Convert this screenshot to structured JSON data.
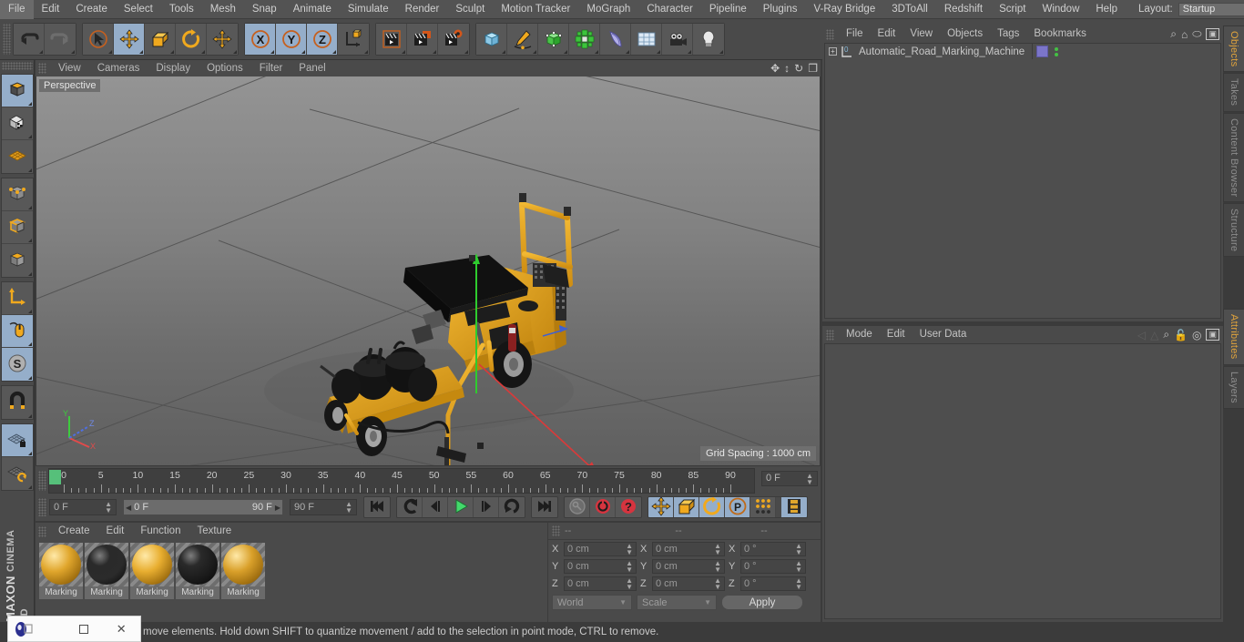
{
  "menubar": {
    "items": [
      "File",
      "Edit",
      "Create",
      "Select",
      "Tools",
      "Mesh",
      "Snap",
      "Animate",
      "Simulate",
      "Render",
      "Sculpt",
      "Motion Tracker",
      "MoGraph",
      "Character",
      "Pipeline",
      "Plugins",
      "V-Ray Bridge",
      "3DToAll",
      "Redshift",
      "Script",
      "Window",
      "Help"
    ],
    "layout_label": "Layout:",
    "layout_value": "Startup",
    "search_icon": "search-icon"
  },
  "toolbar": {
    "groups": [
      {
        "name": "history",
        "buttons": [
          {
            "name": "undo-button",
            "icon": "undo-icon",
            "active": false
          },
          {
            "name": "redo-button",
            "icon": "redo-icon",
            "active": false,
            "disabled": true
          }
        ]
      },
      {
        "name": "transform-tools",
        "buttons": [
          {
            "name": "live-selection-tool",
            "icon": "cursor-circle-icon",
            "active": false
          },
          {
            "name": "move-tool",
            "icon": "move-arrows-icon",
            "active": true
          },
          {
            "name": "scale-tool",
            "icon": "scale-box-icon",
            "active": false
          },
          {
            "name": "rotate-tool",
            "icon": "rotate-arc-icon",
            "active": false
          },
          {
            "name": "global-local-move-tool",
            "icon": "move-arrows-icon",
            "active": false
          }
        ]
      },
      {
        "name": "axis-locks",
        "buttons": [
          {
            "name": "lock-x-axis",
            "icon": "axis-x-icon",
            "active": true,
            "label": "X"
          },
          {
            "name": "lock-y-axis",
            "icon": "axis-y-icon",
            "active": true,
            "label": "Y"
          },
          {
            "name": "lock-z-axis",
            "icon": "axis-z-icon",
            "active": true,
            "label": "Z"
          },
          {
            "name": "world-object-coordinates",
            "icon": "world-axis-cube-icon",
            "active": false
          }
        ]
      },
      {
        "name": "render-tools",
        "buttons": [
          {
            "name": "render-view-button",
            "icon": "clapboard-view-icon",
            "active": false
          },
          {
            "name": "render-to-picture-viewer-button",
            "icon": "clapboard-picture-icon",
            "active": false
          },
          {
            "name": "render-settings-button",
            "icon": "clapboard-gear-icon",
            "active": false
          }
        ]
      },
      {
        "name": "create-objects",
        "buttons": [
          {
            "name": "add-primitive-cube-button",
            "icon": "blue-cube-icon",
            "active": false
          },
          {
            "name": "add-spline-button",
            "icon": "pen-spline-icon",
            "active": false
          },
          {
            "name": "add-generator-button",
            "icon": "green-cube-icon",
            "active": false
          },
          {
            "name": "add-mograph-button",
            "icon": "green-cluster-icon",
            "active": false
          },
          {
            "name": "add-deformer-button",
            "icon": "bend-deformer-icon",
            "active": false
          },
          {
            "name": "add-scene-object-button",
            "icon": "floor-grid-icon",
            "active": false
          },
          {
            "name": "add-camera-button",
            "icon": "camera-icon",
            "active": false
          },
          {
            "name": "add-light-button",
            "icon": "lightbulb-icon",
            "active": false
          }
        ]
      }
    ]
  },
  "lefttools": {
    "groups": [
      {
        "name": "mode-group-1",
        "buttons": [
          {
            "name": "make-editable-button",
            "icon": "editable-cube-icon",
            "active": true
          },
          {
            "name": "model-mode-button",
            "icon": "checker-cube-icon",
            "active": false
          },
          {
            "name": "texture-mode-button",
            "icon": "texture-grid-icon",
            "active": false
          }
        ]
      },
      {
        "name": "component-group",
        "buttons": [
          {
            "name": "points-mode-button",
            "icon": "points-cube-icon",
            "active": false
          },
          {
            "name": "edges-mode-button",
            "icon": "edges-cube-icon",
            "active": false
          },
          {
            "name": "polygons-mode-button",
            "icon": "polygons-cube-icon",
            "active": false
          }
        ]
      },
      {
        "name": "axis-group",
        "buttons": [
          {
            "name": "enable-axis-modification-button",
            "icon": "axis-L-icon",
            "active": false
          },
          {
            "name": "viewport-solo-button",
            "icon": "mouse-icon",
            "active": true
          },
          {
            "name": "enable-snapping-button",
            "icon": "snap-S-icon",
            "active": true
          }
        ]
      },
      {
        "name": "magnet-group",
        "buttons": [
          {
            "name": "magnet-tool-button",
            "icon": "magnet-icon",
            "active": false
          }
        ]
      },
      {
        "name": "workplane-group",
        "buttons": [
          {
            "name": "lock-workplane-button",
            "icon": "grid-lock-icon",
            "active": true
          },
          {
            "name": "planar-workplane-button",
            "icon": "grid-rotate-icon",
            "active": false
          }
        ]
      }
    ],
    "brand": "MAXON",
    "brand_sub": "CINEMA 4D"
  },
  "viewport": {
    "menu": [
      "View",
      "Cameras",
      "Display",
      "Options",
      "Filter",
      "Panel"
    ],
    "nav_icons": [
      "pan-icon",
      "dolly-icon",
      "rotate-icon",
      "maximize-icon"
    ],
    "label": "Perspective",
    "grid_spacing": "Grid Spacing : 1000 cm",
    "axis_gizmo": {
      "x": "X",
      "y": "Y",
      "z": "Z"
    },
    "scene_object": "Automatic Road Marking Machine"
  },
  "timeline": {
    "ticks": [
      0,
      5,
      10,
      15,
      20,
      25,
      30,
      35,
      40,
      45,
      50,
      55,
      60,
      65,
      70,
      75,
      80,
      85,
      90
    ],
    "current_frame_field": "0 F",
    "start_frame": "0 F",
    "range_start": "0 F",
    "range_end": "90 F",
    "end_frame": "90 F",
    "playhead_frame": 0,
    "transport": [
      {
        "name": "go-to-start-button",
        "icon": "skip-start-icon",
        "active": false
      },
      {
        "name": "play-backwards-button",
        "icon": "reverse-icon",
        "active": false
      },
      {
        "name": "previous-frame-button",
        "icon": "step-back-icon",
        "active": false
      },
      {
        "name": "play-button",
        "icon": "play-icon",
        "active": false
      },
      {
        "name": "next-frame-button",
        "icon": "step-forward-icon",
        "active": false
      },
      {
        "name": "play-forwards-loop-button",
        "icon": "loop-icon",
        "active": false
      },
      {
        "name": "go-to-end-button",
        "icon": "skip-end-icon",
        "active": false
      },
      {
        "name": "autokeying-button",
        "icon": "key-icon",
        "active": false
      },
      {
        "name": "record-active-objects-button",
        "icon": "record-icon",
        "active": false
      },
      {
        "name": "keyframe-selection-button",
        "icon": "question-icon",
        "active": false
      }
    ],
    "record_toggles": [
      {
        "name": "record-position-toggle",
        "icon": "move-arrows-icon",
        "active": true
      },
      {
        "name": "record-scale-toggle",
        "icon": "scale-box-icon",
        "active": true
      },
      {
        "name": "record-rotation-toggle",
        "icon": "rotate-arc-icon",
        "active": true
      },
      {
        "name": "record-pla-toggle",
        "icon": "p-circle-icon",
        "active": true
      },
      {
        "name": "record-parameter-toggle",
        "icon": "dots-grid-icon",
        "active": false
      },
      {
        "name": "keyframe-mode-toggle",
        "icon": "filmstrip-icon",
        "active": true
      }
    ]
  },
  "materials": {
    "menu": [
      "Create",
      "Edit",
      "Function",
      "Texture"
    ],
    "items": [
      {
        "name": "Marking",
        "swatch": "#e0a62c",
        "dark": false
      },
      {
        "name": "Marking",
        "swatch": "#2b2b2b",
        "dark": true
      },
      {
        "name": "Marking",
        "swatch": "#e8ae30",
        "dark": false
      },
      {
        "name": "Marking",
        "swatch": "#1b1b1b",
        "dark": true
      },
      {
        "name": "Marking",
        "swatch": "#d9a02a",
        "dark": false
      }
    ]
  },
  "coordinates": {
    "headers": [
      "--",
      "--",
      "--"
    ],
    "rows": [
      {
        "label": "X",
        "position": "0 cm",
        "size": "0 cm",
        "rotation": "0 °"
      },
      {
        "label": "Y",
        "position": "0 cm",
        "size": "0 cm",
        "rotation": "0 °"
      },
      {
        "label": "Z",
        "position": "0 cm",
        "size": "0 cm",
        "rotation": "0 °"
      }
    ],
    "system": "World",
    "mode": "Scale",
    "apply_label": "Apply"
  },
  "objects_panel": {
    "menu": [
      "File",
      "Edit",
      "View",
      "Objects",
      "Tags",
      "Bookmarks"
    ],
    "icons": [
      "search-icon",
      "home-icon",
      "ellipse-icon",
      "new-window-icon"
    ],
    "items": [
      {
        "name": "Automatic_Road_Marking_Machine",
        "layer_number": "0",
        "tag_color": "#7b75c9"
      }
    ]
  },
  "attributes_panel": {
    "menu": [
      "Mode",
      "Edit",
      "User Data"
    ],
    "icons": [
      "back-arrow-icon",
      "forward-arrow-icon",
      "search-icon",
      "lock-icon",
      "target-icon",
      "new-window-icon"
    ]
  },
  "dock": {
    "top_tabs": [
      {
        "label": "Objects",
        "active": true
      },
      {
        "label": "Takes",
        "active": false
      },
      {
        "label": "Content Browser",
        "active": false
      },
      {
        "label": "Structure",
        "active": false
      }
    ],
    "bottom_tabs": [
      {
        "label": "Attributes",
        "active": true
      },
      {
        "label": "Layers",
        "active": false
      }
    ]
  },
  "statusbar": {
    "text": "move elements. Hold down SHIFT to quantize movement / add to the selection in point mode, CTRL to remove."
  },
  "popup": {
    "icon": "app-icon",
    "minimize": "–",
    "maximize": "square",
    "close": "✕"
  }
}
